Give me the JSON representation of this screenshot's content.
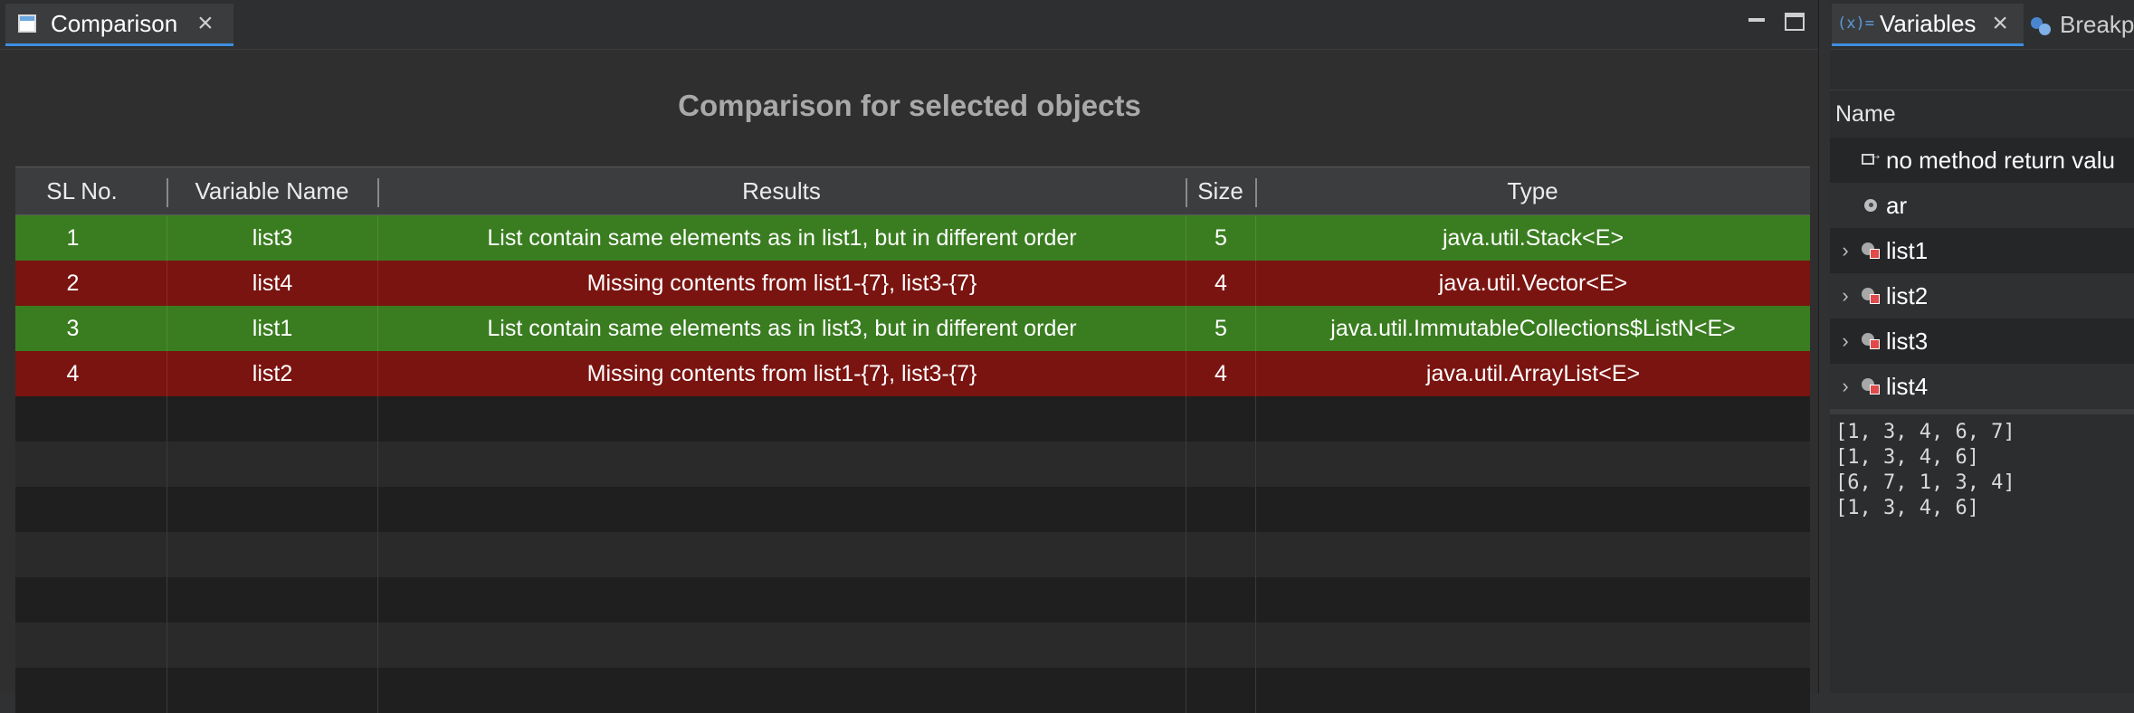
{
  "comparison_view": {
    "tab_label": "Comparison",
    "heading": "Comparison for selected objects",
    "columns": [
      "SL No.",
      "Variable Name",
      "Results",
      "Size",
      "Type"
    ],
    "rows": [
      {
        "sl": "1",
        "name": "list3",
        "result": "List contain same elements as in list1, but in different order",
        "size": "5",
        "type": "java.util.Stack<E>",
        "status": "match"
      },
      {
        "sl": "2",
        "name": "list4",
        "result": "Missing contents from list1-{7}, list3-{7}",
        "size": "4",
        "type": "java.util.Vector<E>",
        "status": "diff"
      },
      {
        "sl": "3",
        "name": "list1",
        "result": "List contain same elements as in list3, but in different order",
        "size": "5",
        "type": "java.util.ImmutableCollections$ListN<E>",
        "status": "match"
      },
      {
        "sl": "4",
        "name": "list2",
        "result": "Missing contents from list1-{7}, list3-{7}",
        "size": "4",
        "type": "java.util.ArrayList<E>",
        "status": "diff"
      }
    ]
  },
  "variables_view": {
    "tab_label": "Variables",
    "tab_icon_text": "(x)=",
    "second_tab_label": "Breakp",
    "column_header": "Name",
    "items": [
      {
        "label": "no method return valu",
        "kind": "return"
      },
      {
        "label": "ar",
        "kind": "local"
      },
      {
        "label": "list1",
        "kind": "object"
      },
      {
        "label": "list2",
        "kind": "object"
      },
      {
        "label": "list3",
        "kind": "object"
      },
      {
        "label": "list4",
        "kind": "object"
      }
    ],
    "detail_lines": [
      "[1, 3, 4, 6, 7]",
      "[1, 3, 4, 6]",
      "[6, 7, 1, 3, 4]",
      "[1, 3, 4, 6]"
    ]
  },
  "colors": {
    "match_row": "#3a7d20",
    "diff_row": "#7a1410",
    "active_tab_underline": "#3d8ee0"
  }
}
